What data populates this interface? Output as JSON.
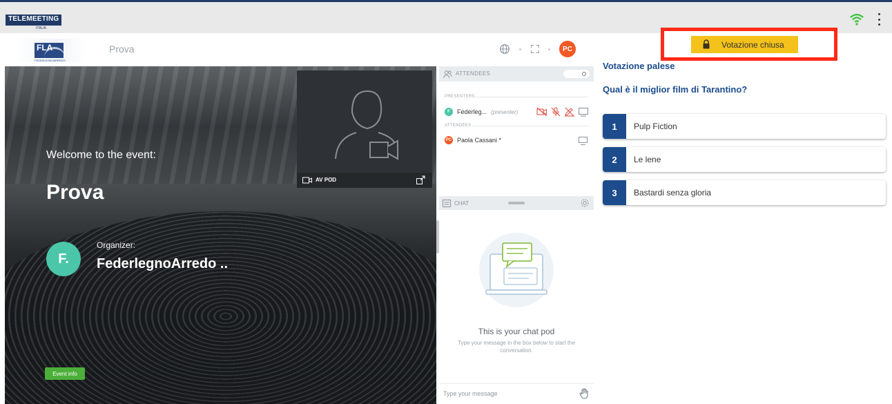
{
  "app": {
    "brand": "TELEMEETING",
    "brand_sub": "ITALIA"
  },
  "header": {
    "org_logo_text": "FLA",
    "org_logo_sub": "FEDERLEGNOARREDO",
    "event_title": "Prova",
    "user_initials": "PC"
  },
  "poll_status": {
    "label": "Votazione chiusa",
    "color": "#f4c21a",
    "highlight_color": "#ff2a17"
  },
  "welcome": {
    "intro": "Welcome to the event:",
    "event_name": "Prova",
    "organizer_label": "Organizer:",
    "organizer_initial": "F.",
    "organizer_name": "FederlegnoArredo ..",
    "event_info_button": "Event info"
  },
  "av_pod": {
    "label": "AV POD"
  },
  "attendees_pod": {
    "title": "ATTENDEES",
    "presenters_label": "PRESENTERS",
    "attendees_label": "ATTENDEES",
    "presenter": {
      "initial": "F",
      "name": "Federleg...",
      "role": "(presenter)"
    },
    "attendee": {
      "initials": "PC",
      "name": "Paola Cassani *"
    }
  },
  "chat_pod": {
    "title": "CHAT",
    "empty_title": "This is your chat pod",
    "empty_hint": "Type your message in the box below to start the conversation.",
    "input_placeholder": "Type your message"
  },
  "poll": {
    "type": "Votazione palese",
    "question": "Qual è il miglior film di Tarantino?",
    "options": [
      {
        "number": "1",
        "label": "Pulp Fiction"
      },
      {
        "number": "2",
        "label": "Le lene"
      },
      {
        "number": "3",
        "label": "Bastardi senza gloria"
      }
    ]
  },
  "colors": {
    "primary": "#1c4c8c",
    "presenter_avatar": "#4bc6a8",
    "user_avatar": "#f15a24",
    "event_info": "#4caf3a"
  }
}
